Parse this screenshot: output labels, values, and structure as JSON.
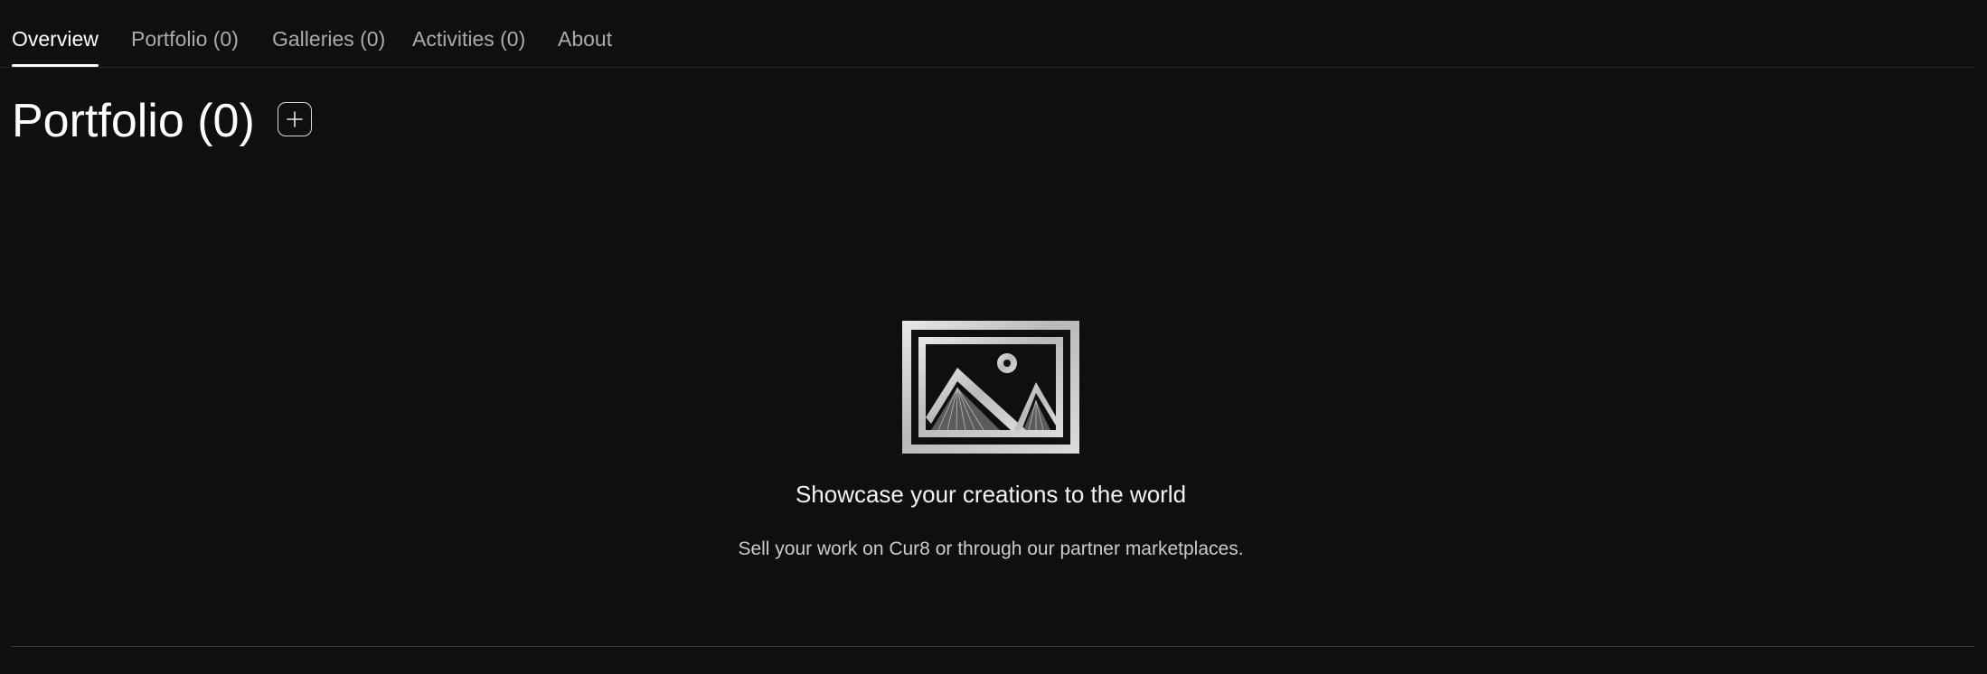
{
  "tabs": [
    {
      "label": "Overview",
      "active": true
    },
    {
      "label": "Portfolio (0)",
      "active": false
    },
    {
      "label": "Galleries (0)",
      "active": false
    },
    {
      "label": "Activities (0)",
      "active": false
    },
    {
      "label": "About",
      "active": false
    }
  ],
  "page": {
    "title": "Portfolio (0)",
    "add_icon": "plus-icon"
  },
  "empty_state": {
    "icon": "image-placeholder-icon",
    "heading": "Showcase your creations to the world",
    "subtext": "Sell your work on Cur8 or through our partner marketplaces."
  },
  "colors": {
    "background": "#0e0f11",
    "text_primary": "#ffffff",
    "text_muted": "#a9abb1",
    "divider": "#3a3c41"
  }
}
